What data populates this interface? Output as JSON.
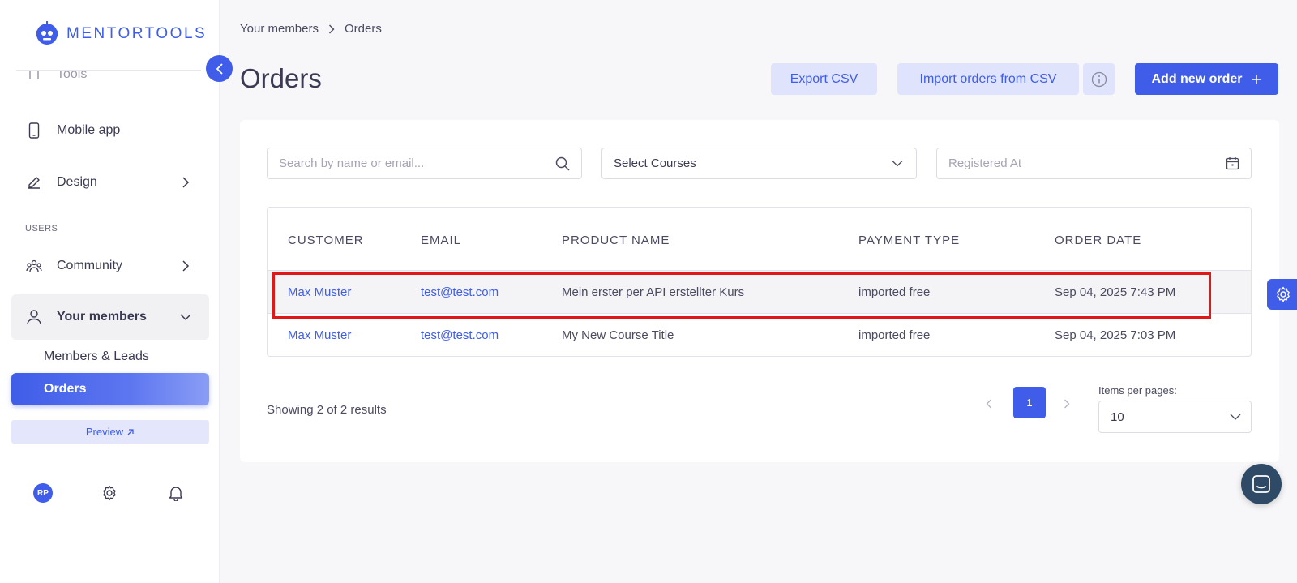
{
  "brand": {
    "name": "MENTORTOOLS",
    "color": "#3f5de8"
  },
  "sidebar": {
    "partial_item": "Tools",
    "items": [
      {
        "label": "Mobile app",
        "icon": "phone-icon"
      },
      {
        "label": "Design",
        "icon": "pencil-icon"
      }
    ],
    "section_users": "USERS",
    "community": "Community",
    "your_members": "Your members",
    "sub_items": [
      "Members & Leads",
      "Orders"
    ],
    "preview": "Preview",
    "avatar_initials": "RP"
  },
  "breadcrumb": {
    "parent": "Your members",
    "current": "Orders"
  },
  "page": {
    "title": "Orders"
  },
  "toolbar": {
    "export": "Export CSV",
    "import": "Import orders from CSV",
    "add": "Add new order"
  },
  "filters": {
    "search_placeholder": "Search by name or email...",
    "courses": "Select Courses",
    "registered_placeholder": "Registered At"
  },
  "table": {
    "headers": [
      "CUSTOMER",
      "EMAIL",
      "PRODUCT NAME",
      "PAYMENT TYPE",
      "ORDER DATE"
    ],
    "rows": [
      [
        "Max Muster",
        "test@test.com",
        "Mein erster per API erstellter Kurs",
        "imported free",
        "Sep 04, 2025 7:43 PM"
      ],
      [
        "Max Muster",
        "test@test.com",
        "My New Course Title",
        "imported free",
        "Sep 04, 2025 7:03 PM"
      ]
    ]
  },
  "pagination": {
    "showing": "Showing 2 of 2 results",
    "current_page": "1",
    "items_per_page_label": "Items per pages:",
    "items_per_page": "10"
  }
}
